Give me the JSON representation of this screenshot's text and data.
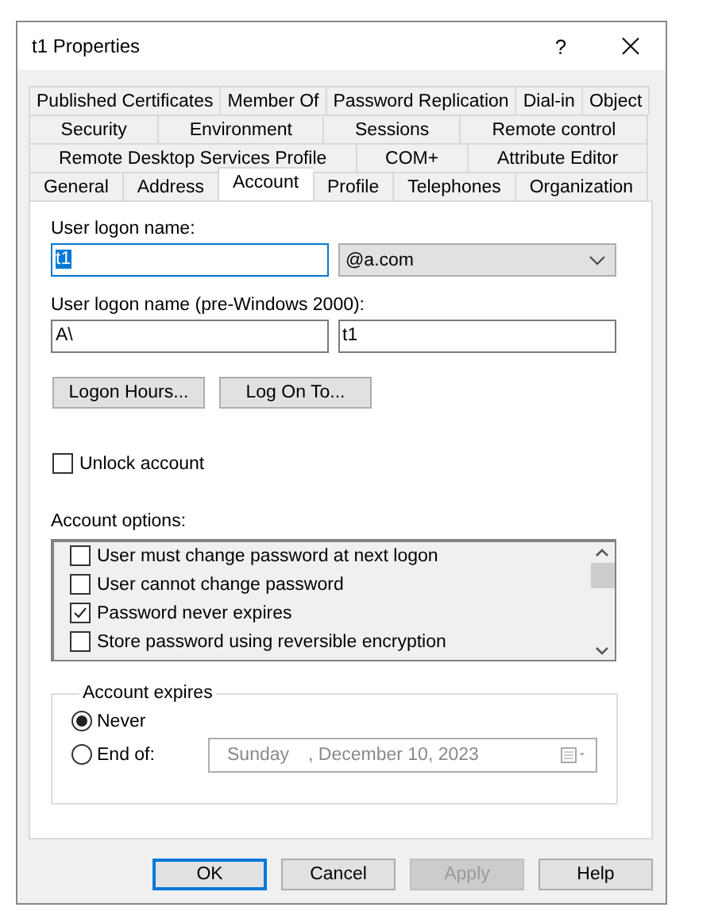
{
  "window": {
    "title": "t1 Properties",
    "help": "?"
  },
  "tab_rows": [
    [
      {
        "label": "Published Certificates",
        "selected": false
      },
      {
        "label": "Member Of",
        "selected": false
      },
      {
        "label": "Password Replication",
        "selected": false
      },
      {
        "label": "Dial-in",
        "selected": false
      },
      {
        "label": "Object",
        "selected": false
      }
    ],
    [
      {
        "label": "Security",
        "selected": false
      },
      {
        "label": "Environment",
        "selected": false
      },
      {
        "label": "Sessions",
        "selected": false
      },
      {
        "label": "Remote control",
        "selected": false
      }
    ],
    [
      {
        "label": "Remote Desktop Services Profile",
        "selected": false
      },
      {
        "label": "COM+",
        "selected": false
      },
      {
        "label": "Attribute Editor",
        "selected": false
      }
    ],
    [
      {
        "label": "General",
        "selected": false
      },
      {
        "label": "Address",
        "selected": false
      },
      {
        "label": "Account",
        "selected": true
      },
      {
        "label": "Profile",
        "selected": false
      },
      {
        "label": "Telephones",
        "selected": false
      },
      {
        "label": "Organization",
        "selected": false
      }
    ]
  ],
  "logon_name": {
    "label": "User logon name:",
    "value": "t1",
    "text_selected": true,
    "domain": "@a.com"
  },
  "pre_windows_2000": {
    "label": "User logon name (pre-Windows 2000):",
    "domain": "A\\",
    "value": "t1"
  },
  "account_buttons": [
    "Logon Hours...",
    "Log On To..."
  ],
  "unlock": {
    "label": "Unlock account",
    "checked": false
  },
  "account_options": {
    "label": "Account options:",
    "items": [
      {
        "label": "User must change password at next logon",
        "checked": false
      },
      {
        "label": "User cannot change password",
        "checked": false
      },
      {
        "label": "Password never expires",
        "checked": true
      },
      {
        "label": "Store password using reversible encryption",
        "checked": false
      }
    ]
  },
  "account_expires": {
    "legend": "Account expires",
    "options": [
      {
        "label": "Never",
        "selected": true
      },
      {
        "label": "End of:",
        "selected": false
      }
    ],
    "date": {
      "day": "Sunday",
      "date": ", December 10, 2023",
      "disabled": true
    }
  },
  "buttons": [
    {
      "label": "OK",
      "default": true,
      "disabled": false
    },
    {
      "label": "Cancel",
      "default": false,
      "disabled": false
    },
    {
      "label": "Apply",
      "default": false,
      "disabled": true
    },
    {
      "label": "Help",
      "default": false,
      "disabled": false
    }
  ]
}
